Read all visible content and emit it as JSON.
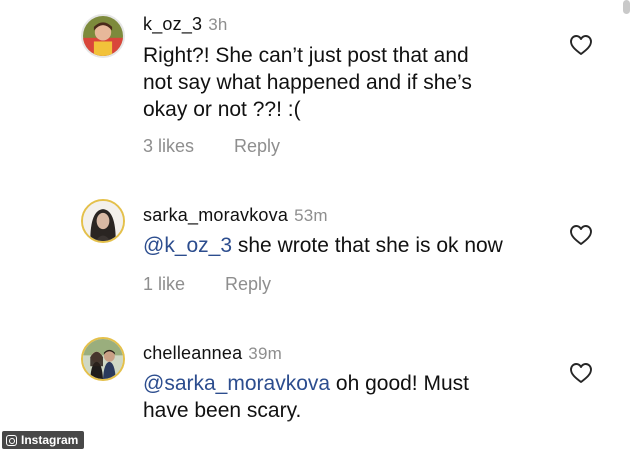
{
  "comments": [
    {
      "username": "k_oz_3",
      "time": "3h",
      "lines": [
        "Right?! She can’t just post that and",
        "not say what happened and if she’s",
        "okay or not ??! :("
      ],
      "likes": "3 likes",
      "reply": "Reply",
      "like_icon": "heart-icon"
    },
    {
      "username": "sarka_moravkova",
      "time": "53m",
      "mention": "@k_oz_3",
      "text": " she wrote that she is ok now",
      "likes": "1 like",
      "reply": "Reply",
      "like_icon": "heart-icon"
    },
    {
      "username": "chelleannea",
      "time": "39m",
      "mention": "@sarka_moravkova",
      "text": " oh good! Must",
      "line2": "have been scary.",
      "like_icon": "heart-icon"
    }
  ],
  "watermark": {
    "label": "Instagram"
  },
  "colors": {
    "mention": "#2c4d8e",
    "secondary_text": "#8e8e8e",
    "watermark_bg": "#282828"
  }
}
